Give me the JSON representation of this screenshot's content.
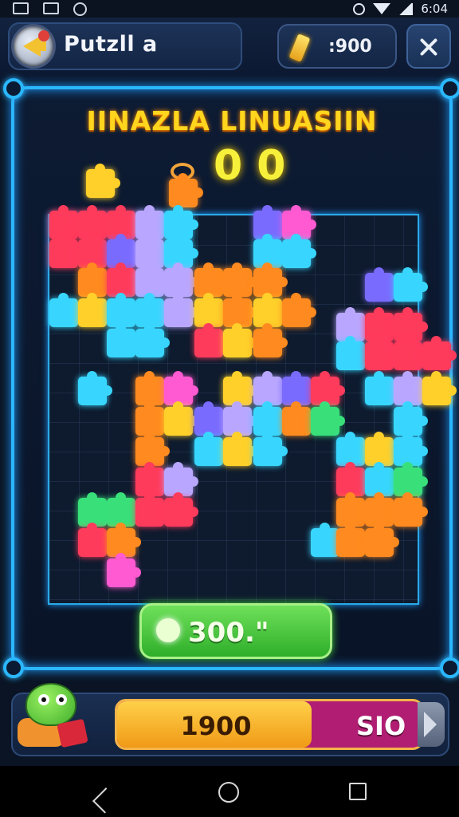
{
  "status_bar": {
    "time": "6:04"
  },
  "header": {
    "title": "Putzll a",
    "coins": ":900",
    "back_icon": "back-arrow-icon",
    "coin_icon": "gold-bar-icon",
    "close_icon": "close-icon"
  },
  "game": {
    "title": "IINAZLA LINUASIIN",
    "score": "0 0",
    "hint_button": {
      "label": "300.\"",
      "icon": "sparkle-icon"
    }
  },
  "bottom": {
    "progress_value": "1900",
    "progress_fraction": 0.64,
    "progress_tag": "SIO",
    "next_icon": "chevron-right-icon",
    "mascot_icon": "dino-mascot-icon"
  },
  "nav": {
    "back_icon": "nav-back-icon",
    "home_icon": "nav-home-icon",
    "recents_icon": "nav-recents-icon"
  },
  "colors": {
    "frame_glow": "#2bb7ff",
    "title_yellow": "#ffd51e",
    "hint_green": "#2fae2a",
    "progress_orange": "#f09a16",
    "progress_magenta": "#b01d73"
  }
}
